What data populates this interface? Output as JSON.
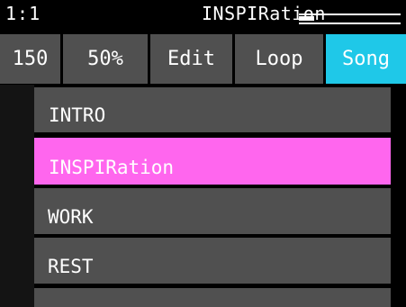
{
  "header": {
    "position": "1:1",
    "song_title": "INSPIRation",
    "progress_fraction": 0.15
  },
  "tabs": [
    {
      "label": "150",
      "active": false
    },
    {
      "label": "50%",
      "active": false
    },
    {
      "label": "Edit",
      "active": false
    },
    {
      "label": "Loop",
      "active": false
    },
    {
      "label": "Song",
      "active": true
    }
  ],
  "sections": [
    {
      "label": "INTRO",
      "selected": false
    },
    {
      "label": "INSPIRation",
      "selected": true
    },
    {
      "label": "WORK",
      "selected": false
    },
    {
      "label": "REST",
      "selected": false
    },
    {
      "label": "",
      "selected": false
    }
  ],
  "colors": {
    "background": "#000000",
    "item": "#505050",
    "active_tab": "#1fc8e8",
    "selected_item": "#ff66ee",
    "text": "#ffffff"
  }
}
